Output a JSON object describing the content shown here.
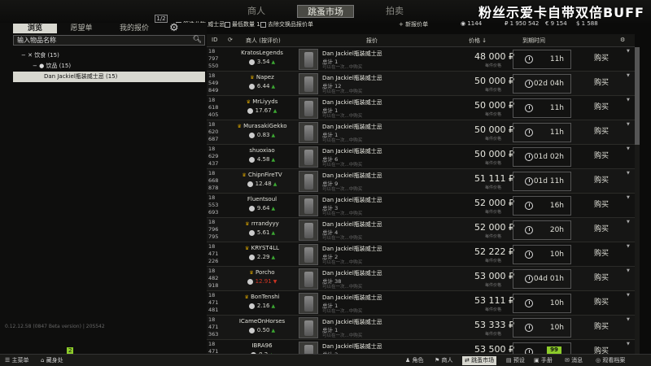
{
  "topnav": {
    "tabs": [
      {
        "label": "商人",
        "active": false
      },
      {
        "label": "跳蚤市场",
        "active": true
      },
      {
        "label": "拍卖",
        "active": false
      }
    ],
    "overlay": "粉丝示爱卡自带双倍BUFF"
  },
  "left": {
    "subtabs": [
      "浏览",
      "愿望单",
      "我的报价"
    ],
    "badge": "1/2",
    "search_placeholder": "输入物品名称",
    "tree": [
      {
        "label": "饮食 (15)",
        "depth": 0
      },
      {
        "label": "饮品 (15)",
        "depth": 1
      },
      {
        "label": "Dan Jackiel瓶装威士忌 (15)",
        "depth": 2,
        "selected": true
      }
    ],
    "version": "0.12.12.58 (0847 Beta version) | 20S542"
  },
  "filterbar": {
    "items": [
      "筛选此物 威士忌",
      "最低数量 1",
      "去除交换品报价单",
      "+ 新报价单"
    ],
    "balance_label": "1144",
    "roubles": "₽ 1 950 542",
    "euros": "€ 9 154",
    "dollars": "$ 1 588"
  },
  "table": {
    "headers": {
      "id": "ID",
      "seller": "商人 (按评价)",
      "offer": "报价",
      "price": "价格",
      "expire": "到期时间"
    },
    "rows": [
      {
        "id": "18 797 550",
        "seller": "KratosLegends",
        "crown": false,
        "rep": "3.54",
        "trend": "up",
        "name": "Dan Jackiel瓶装威士忌",
        "qty": "总计 1",
        "price": "48 000 ₽",
        "expire": "11h"
      },
      {
        "id": "18 549 849",
        "seller": "Napez",
        "crown": true,
        "rep": "6.44",
        "trend": "up",
        "name": "Dan Jackiel瓶装威士忌",
        "qty": "总计 12",
        "price": "50 000 ₽",
        "expire": "02d 04h"
      },
      {
        "id": "18 618 405",
        "seller": "MrLiyyds",
        "crown": true,
        "rep": "17.67",
        "trend": "up",
        "name": "Dan Jackiel瓶装威士忌",
        "qty": "总计 1",
        "price": "50 000 ₽",
        "expire": "11h"
      },
      {
        "id": "18 620 687",
        "seller": "MurasakiGekko",
        "crown": true,
        "rep": "0.83",
        "trend": "up",
        "name": "Dan Jackiel瓶装威士忌",
        "qty": "总计 1",
        "price": "50 000 ₽",
        "expire": "11h"
      },
      {
        "id": "18 629 437",
        "seller": "shuoxiao",
        "crown": false,
        "rep": "4.58",
        "trend": "up",
        "name": "Dan Jackiel瓶装威士忌",
        "qty": "总计 6",
        "price": "50 000 ₽",
        "expire": "01d 02h"
      },
      {
        "id": "18 668 878",
        "seller": "ChipnFireTV",
        "crown": true,
        "rep": "12.48",
        "trend": "up",
        "name": "Dan Jackiel瓶装威士忌",
        "qty": "总计 9",
        "price": "51 111 ₽",
        "expire": "01d 11h"
      },
      {
        "id": "18 553 693",
        "seller": "Fluentsoul",
        "crown": false,
        "rep": "9.64",
        "trend": "up",
        "name": "Dan Jackiel瓶装威士忌",
        "qty": "总计 3",
        "price": "52 000 ₽",
        "expire": "16h"
      },
      {
        "id": "18 796 795",
        "seller": "rrrandyyy",
        "crown": true,
        "rep": "5.61",
        "trend": "up",
        "name": "Dan Jackiel瓶装威士忌",
        "qty": "总计 4",
        "price": "52 000 ₽",
        "expire": "20h"
      },
      {
        "id": "18 471 226",
        "seller": "KRYST4LL",
        "crown": true,
        "rep": "2.29",
        "trend": "up",
        "name": "Dan Jackiel瓶装威士忌",
        "qty": "总计 2",
        "price": "52 222 ₽",
        "expire": "10h"
      },
      {
        "id": "18 482 918",
        "seller": "Porcho",
        "crown": true,
        "rep": "12.91",
        "trend": "down",
        "neg": true,
        "name": "Dan Jackiel瓶装威士忌",
        "qty": "总计 38",
        "price": "53 000 ₽",
        "expire": "04d 01h"
      },
      {
        "id": "18 471 481",
        "seller": "BonTenshi",
        "crown": true,
        "rep": "2.16",
        "trend": "up",
        "name": "Dan Jackiel瓶装威士忌",
        "qty": "总计 1",
        "price": "53 111 ₽",
        "expire": "10h"
      },
      {
        "id": "18 471 363",
        "seller": "ICameOnHorses",
        "crown": false,
        "rep": "0.50",
        "trend": "up",
        "name": "Dan Jackiel瓶装威士忌",
        "qty": "总计 1",
        "price": "53 333 ₽",
        "expire": "10h"
      },
      {
        "id": "18 471",
        "seller": "IBRA96",
        "crown": false,
        "rep": "0.2",
        "trend": "up",
        "name": "Dan Jackiel瓶装威士忌",
        "qty": "总计 2",
        "price": "53 500 ₽",
        "expire": ""
      }
    ],
    "price_sub": "每件价格",
    "item_sub": "可以在一次...中购买",
    "buy_label": "购买"
  },
  "bottombar": {
    "left": [
      "主菜单",
      "藏身处"
    ],
    "hp": "2",
    "right": [
      "角色",
      "商人",
      "跳蚤市场",
      "预设",
      "手册",
      "消息",
      "观看档案"
    ],
    "active": "跳蚤市场",
    "badge": "99"
  }
}
